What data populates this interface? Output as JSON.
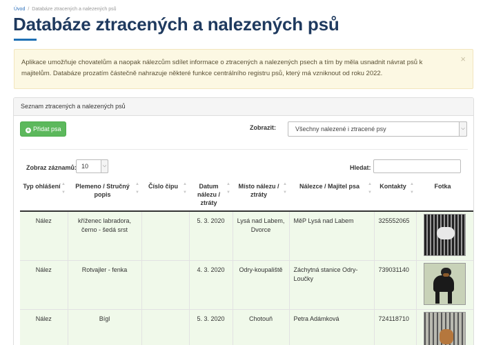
{
  "breadcrumb": {
    "home": "Úvod",
    "separator": "/",
    "current": "Databáze ztracených a nalezených psů"
  },
  "page": {
    "title": "Databáze ztracených a nalezených psů"
  },
  "alert": {
    "text": "Aplikace umožňuje chovatelům a naopak nálezcům sdílet informace o ztracených a nalezených psech a tím by měla usnadnit návrat psů k majitelům. Databáze prozatím částečně nahrazuje některé funkce centrálního registru psů, který má vzniknout od roku 2022.",
    "close": "×"
  },
  "panel": {
    "heading": "Seznam ztracených a nalezených psů"
  },
  "toolbar": {
    "add_label": "Přidat psa",
    "filter_label": "Zobrazit:",
    "filter_value": "Všechny nalezené i ztracené psy"
  },
  "datatable": {
    "length_label": "Zobraz záznamů:",
    "length_value": "10",
    "search_label": "Hledat:",
    "search_value": ""
  },
  "table": {
    "columns": [
      "Typ ohlášení",
      "Plemeno / Stručný popis",
      "Číslo čipu",
      "Datum nálezu / ztráty",
      "Místo nálezu / ztráty",
      "Nálezce / Majitel psa",
      "Kontakty",
      "Fotka"
    ],
    "rows": [
      {
        "type": "Nález",
        "breed": "kříženec labradora, černo - šedá srst",
        "chip": "",
        "date": "5. 3. 2020",
        "place": "Lysá nad Labem, Dvorce",
        "owner": "MěP Lysá nad Labem",
        "contact": "325552065",
        "photo": "photo-caged-dog"
      },
      {
        "type": "Nález",
        "breed": "Rotvajler - fenka",
        "chip": "",
        "date": "4. 3. 2020",
        "place": "Odry-koupaliště",
        "owner": "Záchytná stanice Odry-Loučky",
        "contact": "739031140",
        "photo": "photo-rottweiler"
      },
      {
        "type": "Nález",
        "breed": "Bígl",
        "chip": "",
        "date": "5. 3. 2020",
        "place": "Chotouň",
        "owner": "Petra Adámková",
        "contact": "724118710",
        "photo": "photo-beagle"
      }
    ]
  },
  "colors": {
    "title": "#1f3a5f",
    "accent": "#1e6fb4",
    "add_button": "#5cb85c",
    "alert_bg": "#fcf8e3",
    "row_bg": "#f0f9ea"
  }
}
